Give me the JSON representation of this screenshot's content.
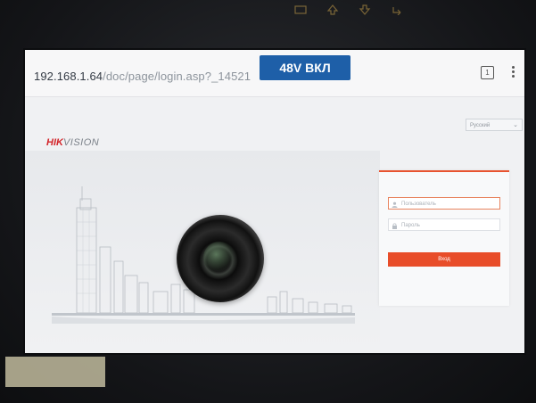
{
  "browser": {
    "url_host": "192.168.1.64",
    "url_path": "/doc/page/login.asp?_14521",
    "tab_count": "1"
  },
  "overlay": {
    "badge_text": "48V ВКЛ"
  },
  "page": {
    "logo_brand": "HIK",
    "logo_suffix": "VISION",
    "language": "Русский",
    "login": {
      "username_placeholder": "Пользователь",
      "password_placeholder": "Пароль",
      "login_button": "Вход"
    }
  },
  "colors": {
    "brand_red": "#d3252a",
    "accent_orange": "#e84d29",
    "badge_blue": "#1e5fa8"
  }
}
